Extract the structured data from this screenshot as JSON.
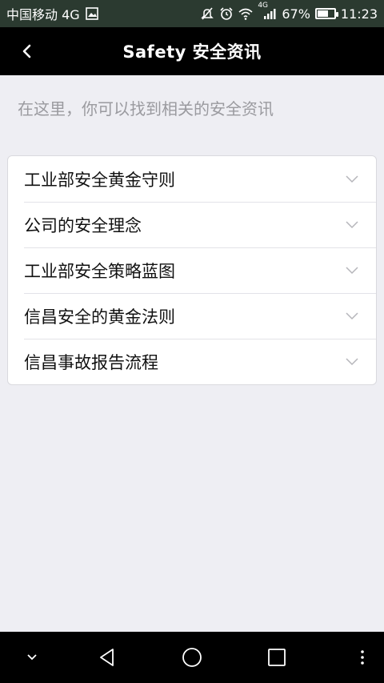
{
  "status_bar": {
    "carrier": "中国移动 4G",
    "network_small": "4G",
    "battery_percent": "67%",
    "battery_level": 0.67,
    "time": "11:23",
    "icons": [
      "image-icon",
      "mute-icon",
      "alarm-icon",
      "wifi-icon",
      "signal-icon",
      "battery-icon"
    ]
  },
  "header": {
    "title": "Safety 安全资讯"
  },
  "hint_text": "在这里，你可以找到相关的安全资讯",
  "list": {
    "items": [
      {
        "label": "工业部安全黄金守则"
      },
      {
        "label": "公司的安全理念"
      },
      {
        "label": "工业部安全策略蓝图"
      },
      {
        "label": "信昌安全的黄金法则"
      },
      {
        "label": "信昌事故报告流程"
      }
    ]
  },
  "colors": {
    "status_bar_bg": "#2b3a30",
    "title_bar_bg": "#000000",
    "page_bg": "#eeeef3",
    "card_bg": "#ffffff",
    "hint_text": "#9a9a9f"
  }
}
